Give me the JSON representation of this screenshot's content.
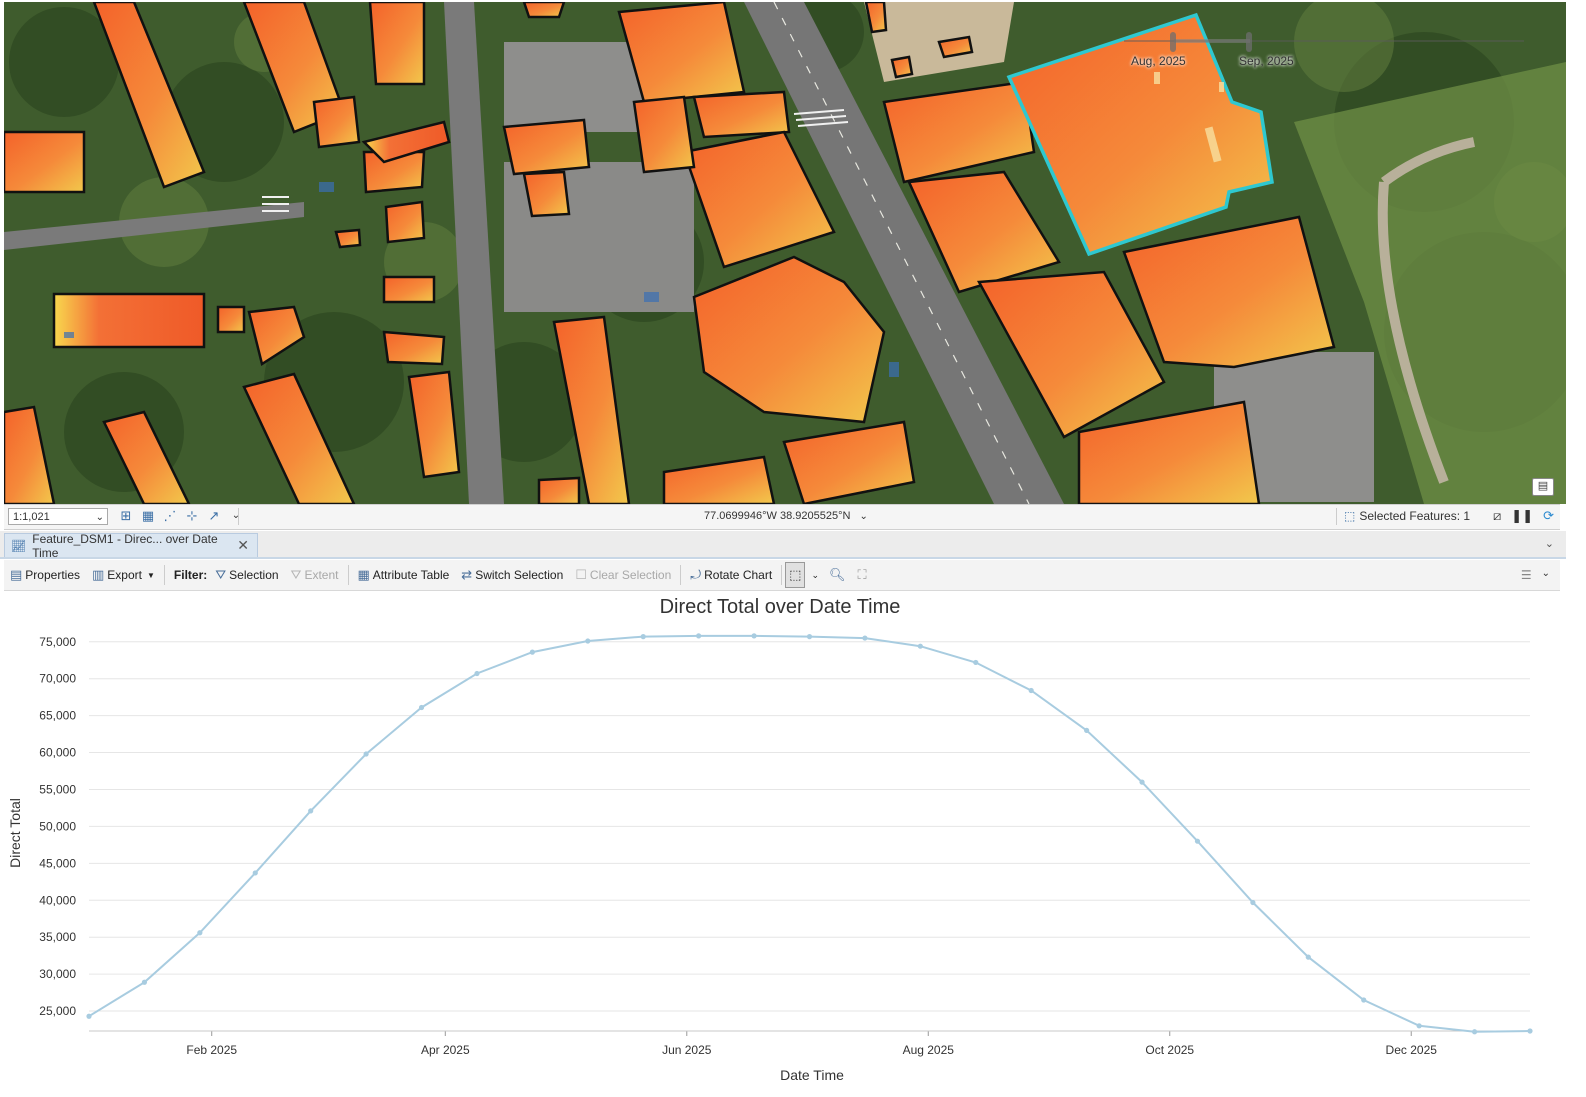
{
  "map": {
    "time_slider": {
      "start_label": "Aug, 2025",
      "end_label": "Sep, 2025"
    }
  },
  "map_status": {
    "scale": "1:1,021",
    "coordinates": "77.0699946°W 38.9205525°N",
    "selected_features": "Selected Features: 1"
  },
  "chart_tab": {
    "label": "Feature_DSM1 - Direc... over Date Time"
  },
  "toolbar": {
    "properties": "Properties",
    "export": "Export",
    "filter_label": "Filter:",
    "selection": "Selection",
    "extent": "Extent",
    "attribute_table": "Attribute Table",
    "switch_selection": "Switch Selection",
    "clear_selection": "Clear Selection",
    "rotate_chart": "Rotate Chart"
  },
  "colors": {
    "line": "#a8cce0",
    "accent": "#2b6cb0",
    "selection": "#2ec8d0"
  },
  "chart_data": {
    "type": "line",
    "title": "Direct Total over Date Time",
    "xlabel": "Date Time",
    "ylabel": "Direct Total",
    "x_tick_labels": [
      "Feb 2025",
      "Apr 2025",
      "Jun 2025",
      "Aug 2025",
      "Oct 2025",
      "Dec 2025"
    ],
    "y_tick_labels": [
      "25,000",
      "30,000",
      "35,000",
      "40,000",
      "45,000",
      "50,000",
      "55,000",
      "60,000",
      "65,000",
      "70,000",
      "75,000"
    ],
    "y_ticks": [
      25000,
      30000,
      35000,
      40000,
      45000,
      50000,
      55000,
      60000,
      65000,
      70000,
      75000
    ],
    "x_ticks": [
      "2025-02-01",
      "2025-04-01",
      "2025-06-01",
      "2025-08-01",
      "2025-10-01",
      "2025-12-01"
    ],
    "xlim": [
      "2025-01-01",
      "2025-12-31"
    ],
    "ylim": [
      22300,
      77000
    ],
    "grid": true,
    "series": [
      {
        "x": [
          "2025-01-01",
          "2025-01-15",
          "2025-01-29",
          "2025-02-12",
          "2025-02-26",
          "2025-03-12",
          "2025-03-26",
          "2025-04-09",
          "2025-04-23",
          "2025-05-07",
          "2025-05-21",
          "2025-06-04",
          "2025-06-18",
          "2025-07-02",
          "2025-07-16",
          "2025-07-30",
          "2025-08-13",
          "2025-08-27",
          "2025-09-10",
          "2025-09-24",
          "2025-10-08",
          "2025-10-22",
          "2025-11-05",
          "2025-11-19",
          "2025-12-03",
          "2025-12-17",
          "2025-12-31"
        ],
        "values": [
          24300,
          28900,
          35600,
          43700,
          52100,
          59800,
          66100,
          70700,
          73600,
          75100,
          75700,
          75800,
          75800,
          75700,
          75500,
          74400,
          72200,
          68400,
          63000,
          56000,
          48000,
          39700,
          32300,
          26500,
          23000,
          22200,
          22300
        ]
      }
    ]
  }
}
